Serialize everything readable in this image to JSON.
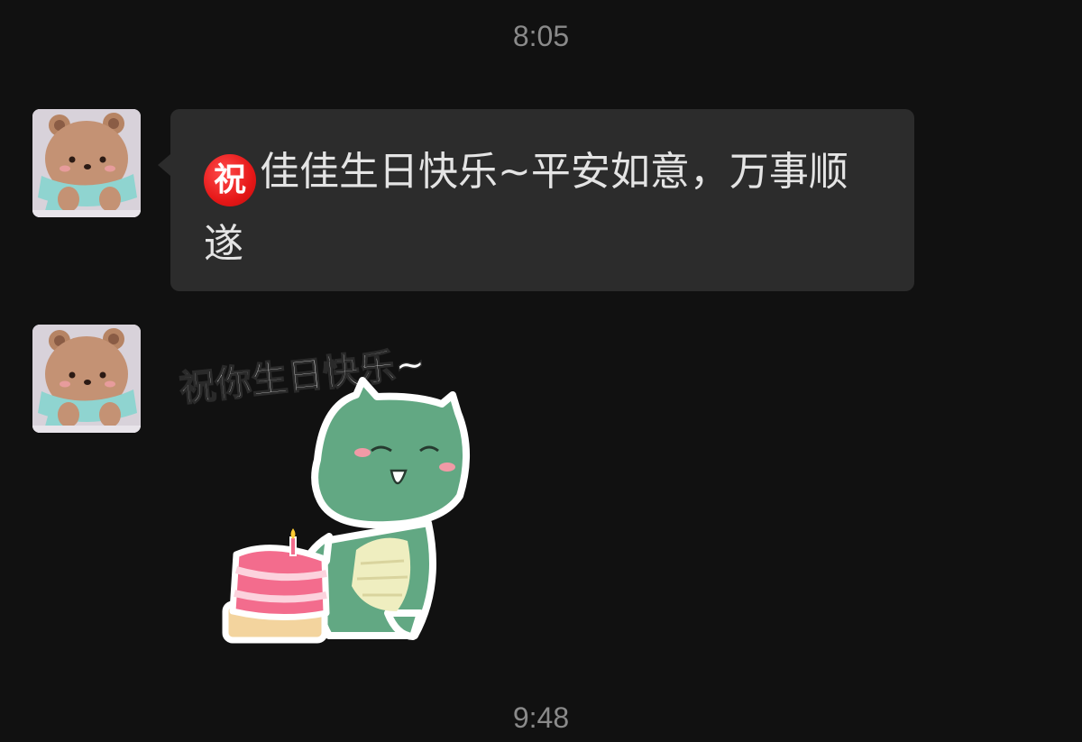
{
  "timestamps": {
    "first": "8:05",
    "second": "9:48"
  },
  "message1": {
    "emoji_char": "祝",
    "emoji_name": "zhu-blessing-emoji",
    "text": "佳佳生日快乐~平安如意，万事顺遂"
  },
  "sticker": {
    "caption": "祝你生日快乐~",
    "icon": "dinosaur-birthday-cake-sticker"
  },
  "colors": {
    "background": "#111111",
    "bubble": "#2c2c2c",
    "timestamp": "#8a8a8a",
    "text": "#e4e4e4"
  }
}
